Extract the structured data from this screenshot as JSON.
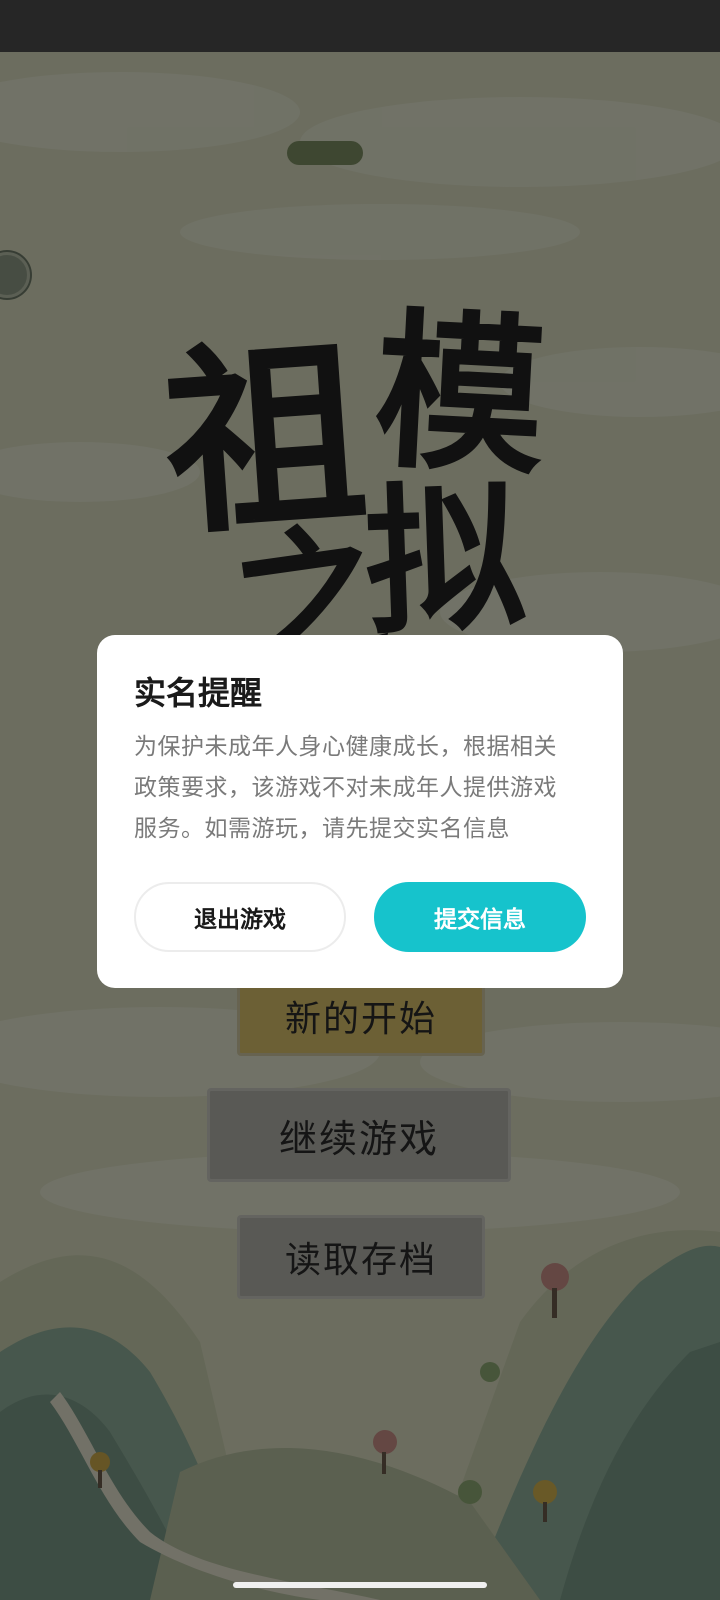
{
  "game": {
    "title_art": "祖之模拟",
    "title_chars": [
      "祖",
      "模",
      "拟",
      "之"
    ],
    "menu": {
      "new_game": "新的开始",
      "continue_game": "继续游戏",
      "load_save": "读取存档"
    }
  },
  "dialog": {
    "title": "实名提醒",
    "body_lines": [
      "为保护未成年人身心健康成长，根据相关",
      "政策要求，该游戏不对未成年人提供游戏",
      "服务。如需游玩，请先提交实名信息"
    ],
    "exit_label": "退出游戏",
    "submit_label": "提交信息",
    "accent_color": "#16c3cc"
  },
  "icons": {
    "top_pill": "pill-badge",
    "side": "avatar-circle-icon"
  }
}
